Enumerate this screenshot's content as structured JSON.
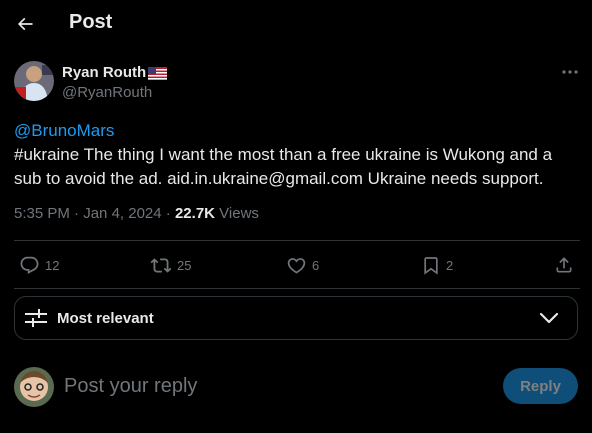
{
  "header": {
    "title": "Post",
    "back_icon": "arrow-left-icon"
  },
  "author": {
    "name": "Ryan Routh",
    "handle": "@RyanRouth",
    "flag": "us-flag-icon",
    "more_icon": "more-horizontal-icon"
  },
  "tweet": {
    "mention": "@BrunoMars",
    "text": "#ukraine The thing I want the most than a free ukraine is Wukong and a sub to avoid the ad. aid.in.ukraine@gmail.com Ukraine needs support.",
    "time": "5:35 PM",
    "separator": "·",
    "date": "Jan 4, 2024",
    "views_count": "22.7K",
    "views_label": "Views"
  },
  "actions": {
    "replies": "12",
    "reposts": "25",
    "likes": "6",
    "bookmarks": "2"
  },
  "sort": {
    "label": "Most relevant"
  },
  "reply": {
    "placeholder": "Post your reply",
    "button_label": "Reply"
  },
  "colors": {
    "background": "#000000",
    "text": "#e7e9ea",
    "secondary": "#71767b",
    "accent": "#1d9bf0",
    "divider": "#2f3336",
    "reply_button": "#0f4e78"
  }
}
